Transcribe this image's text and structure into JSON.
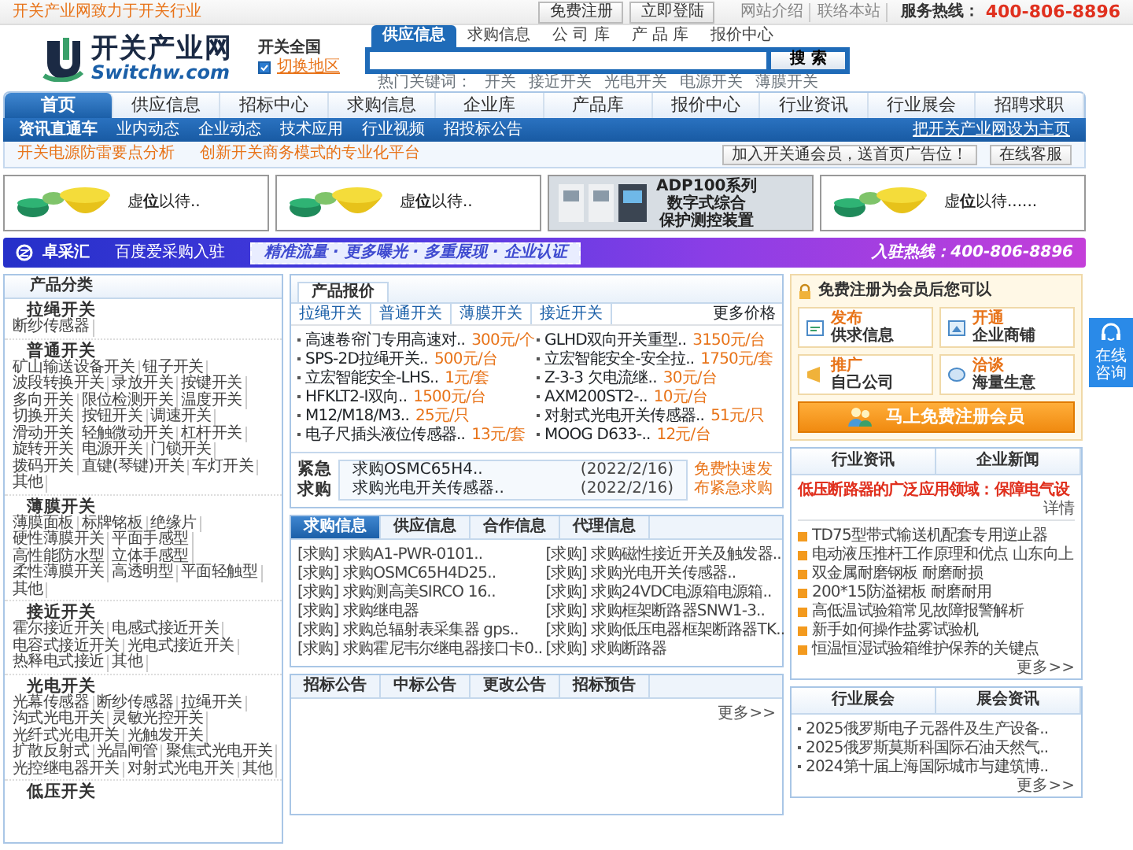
{
  "top_bar": {
    "slogan": "开关产业网致力于开关行业",
    "buttons": [
      "免费注册",
      "立即登陆"
    ],
    "links": [
      "网站介绍",
      "联络本站"
    ],
    "hotline_label": "服务热线：",
    "hotline": "400-806-8896"
  },
  "header": {
    "logo_title": "开关产业网",
    "logo_domain": "Switchw.com",
    "region": "开关全国",
    "switch_region": "切换地区"
  },
  "search": {
    "tabs": [
      {
        "label": "供应信息",
        "selected": true
      },
      {
        "label": "求购信息",
        "selected": false
      },
      {
        "label": "公 司 库",
        "selected": false
      },
      {
        "label": "产 品 库",
        "selected": false
      },
      {
        "label": "报价中心",
        "selected": false
      }
    ],
    "button": "搜 索",
    "hot_label": "热门关键词：",
    "hot_keywords": [
      "开关",
      "接近开关",
      "光电开关",
      "电源开关",
      "薄膜开关"
    ]
  },
  "main_nav": [
    {
      "label": "首页",
      "selected": true
    },
    {
      "label": "供应信息",
      "selected": false
    },
    {
      "label": "招标中心",
      "selected": false
    },
    {
      "label": "求购信息",
      "selected": false
    },
    {
      "label": "企业库",
      "selected": false
    },
    {
      "label": "产品库",
      "selected": false
    },
    {
      "label": "报价中心",
      "selected": false
    },
    {
      "label": "行业资讯",
      "selected": false
    },
    {
      "label": "行业展会",
      "selected": false
    },
    {
      "label": "招聘求职",
      "selected": false
    }
  ],
  "sub_nav": {
    "label": "资讯直通车",
    "items": [
      "业内动态",
      "企业动态",
      "技术应用",
      "行业视频",
      "招投标公告"
    ],
    "homepage_link": "把开关产业网设为主页"
  },
  "notice_bar": {
    "links": [
      "开关电源防雷要点分析",
      "创新开关商务模式的专业化平台"
    ],
    "buttons": [
      "加入开关通会员，送首页广告位！",
      "在线客服"
    ]
  },
  "ads": [
    {
      "kind": "vacant",
      "text": "虚**位**以待.."
    },
    {
      "kind": "vacant",
      "text": "虚**位**以待.."
    },
    {
      "kind": "product",
      "lines": [
        "ADP100系列",
        "数字式综合",
        "保护测控装置"
      ]
    },
    {
      "kind": "vacant",
      "text": "虚**位**以待......"
    }
  ],
  "banner": {
    "brand": "卓采汇",
    "title": "百度爱采购入驻",
    "features": "精准流量 · 更多曝光 · 多重展现 · 企业认证",
    "hotline": "入驻热线：400-806-8896"
  },
  "product_categories": {
    "title": "产品分类",
    "groups": [
      {
        "name": "拉绳开关",
        "items": [
          "断纱传感器"
        ]
      },
      {
        "name": "普通开关",
        "items": [
          "矿山输送设备开关",
          "钮子开关",
          "波段转换开关",
          "录放开关",
          "按键开关",
          "多向开关",
          "限位检测开关",
          "温度开关",
          "切换开关",
          "按钮开关",
          "调速开关",
          "滑动开关",
          "轻触微动开关",
          "杠杆开关",
          "旋转开关",
          "电源开关",
          "门锁开关",
          "拨码开关",
          "直键(琴键)开关",
          "车灯开关",
          "其他"
        ]
      },
      {
        "name": "薄膜开关",
        "items": [
          "薄膜面板",
          "标牌铭板",
          "绝缘片",
          "硬性薄膜开关",
          "平面手感型",
          "高性能防水型",
          "立体手感型",
          "柔性薄膜开关",
          "高透明型",
          "平面轻触型",
          "其他"
        ]
      },
      {
        "name": "接近开关",
        "items": [
          "霍尔接近开关",
          "电感式接近开关",
          "电容式接近开关",
          "光电式接近开关",
          "热释电式接近",
          "其他"
        ]
      },
      {
        "name": "光电开关",
        "items": [
          "光幕传感器",
          "断纱传感器",
          "拉绳开关",
          "沟式光电开关",
          "灵敏光控开关",
          "光纤式光电开关",
          "光触发开关",
          "扩散反射式",
          "光晶闸管",
          "聚焦式光电开关",
          "光控继电器开关",
          "对射式光电开关",
          "其他"
        ]
      },
      {
        "name": "低压开关"
      }
    ]
  },
  "price_panel": {
    "title": "产品报价",
    "tabs": [
      "拉绳开关",
      "普通开关",
      "薄膜开关",
      "接近开关"
    ],
    "more": "更多价格",
    "items": [
      {
        "name": "高速卷帘门专用高速对..",
        "price": "300元/个"
      },
      {
        "name": "GLHD双向开关重型..",
        "price": "3150元/台"
      },
      {
        "name": "SPS-2D拉绳开关..",
        "price": "500元/台"
      },
      {
        "name": "立宏智能安全-安全拉..",
        "price": "1750元/套"
      },
      {
        "name": "立宏智能安全-LHS..",
        "price": "1元/套"
      },
      {
        "name": "Z-3-3 欠电流继..",
        "price": "30元/台"
      },
      {
        "name": "HFKLT2-I双向..",
        "price": "1500元/台"
      },
      {
        "name": "AXM200ST2-..",
        "price": "10元/台"
      },
      {
        "name": "M12/M18/M3..",
        "price": "25元/只"
      },
      {
        "name": "对射式光电开关传感器..",
        "price": "51元/只"
      },
      {
        "name": "电子尺插头液位传感器..",
        "price": "13元/套"
      },
      {
        "name": "MOOG D633-..",
        "price": "12元/台"
      }
    ],
    "urgent": {
      "label": "紧急求购",
      "rows": [
        {
          "title": "求购OSMC65H4..",
          "date": "(2022/2/16)"
        },
        {
          "title": "求购光电开关传感器..",
          "date": "(2022/2/16)"
        }
      ],
      "link": "免费快速发布紧急求购"
    }
  },
  "trade_panel": {
    "tabs": [
      {
        "label": "求购信息",
        "selected": true
      },
      {
        "label": "供应信息",
        "selected": false
      },
      {
        "label": "合作信息",
        "selected": false
      },
      {
        "label": "代理信息",
        "selected": false
      }
    ],
    "items": [
      "[求购] 求购A1-PWR-0101..",
      "[求购] 求购磁性接近开关及触发器..",
      "[求购] 求购OSMC65H4D25..",
      "[求购] 求购光电开关传感器..",
      "[求购] 求购测高美SIRCO 16..",
      "[求购] 求购24VDC电源箱电源箱..",
      "[求购] 求购继电器",
      "[求购] 求购框架断路器SNW1-3..",
      "[求购] 求购总辐射表采集器 gps..",
      "[求购] 求购低压电器框架断路器TK..",
      "[求购] 求购霍尼韦尔继电器接口卡0..",
      "[求购] 求购断路器"
    ]
  },
  "tender_panel": {
    "tabs": [
      "招标公告",
      "中标公告",
      "更改公告",
      "招标预告"
    ],
    "more": "更多>>"
  },
  "member_box": {
    "title": "免费注册为会员后您可以",
    "tiles": [
      {
        "verb": "发布",
        "object": "供求信息"
      },
      {
        "verb": "开通",
        "object": "企业商铺"
      },
      {
        "verb": "推广",
        "object": "自己公司"
      },
      {
        "verb": "洽谈",
        "object": "海量生意"
      }
    ],
    "button": "马上免费注册会员"
  },
  "news_panel": {
    "tabs": [
      "行业资讯",
      "企业新闻"
    ],
    "headline": "低压断路器的广泛应用领域：保障电气设",
    "detail": "详情",
    "items": [
      "TD75型带式输送机配套专用逆止器",
      "电动液压推杆工作原理和优点 山东向上",
      "双金属耐磨钢板 耐磨耐损",
      "200*15防溢裙板 耐磨耐用",
      "高低温试验箱常见故障报警解析",
      "新手如何操作盐雾试验机",
      "恒温恒湿试验箱维护保养的关键点"
    ],
    "more": "更多>>"
  },
  "expo_panel": {
    "tabs": [
      "行业展会",
      "展会资讯"
    ],
    "items": [
      "2025俄罗斯电子元器件及生产设备..",
      "2025俄罗斯莫斯科国际石油天然气..",
      "2024第十届上海国际城市与建筑博.."
    ],
    "more": "更多>>"
  },
  "consult_widget": {
    "label": "在线咨询"
  }
}
